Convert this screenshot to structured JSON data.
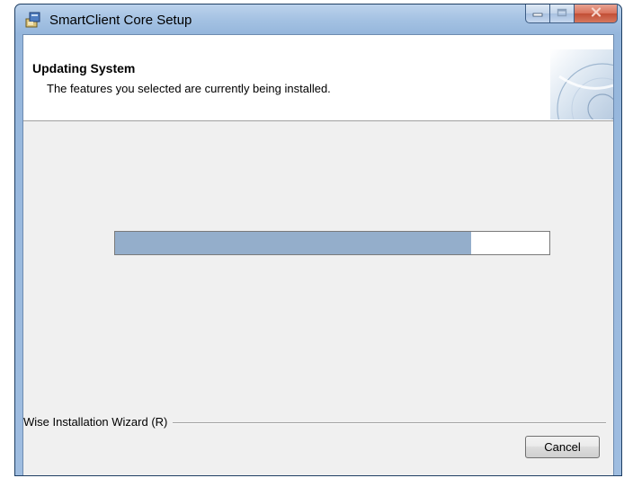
{
  "window": {
    "title": "SmartClient Core Setup"
  },
  "header": {
    "title": "Updating System",
    "subtitle": "The features you selected are currently being installed."
  },
  "progress": {
    "fraction": 0.82,
    "fill_color": "#94aecb"
  },
  "footer": {
    "brand": "Wise Installation Wizard (R)",
    "cancel_label": "Cancel"
  },
  "icons": {
    "app": "installer-icon",
    "minimize": "minimize-icon",
    "maximize": "maximize-icon",
    "close": "close-icon",
    "header_graphic": "cd-disc-graphic"
  }
}
